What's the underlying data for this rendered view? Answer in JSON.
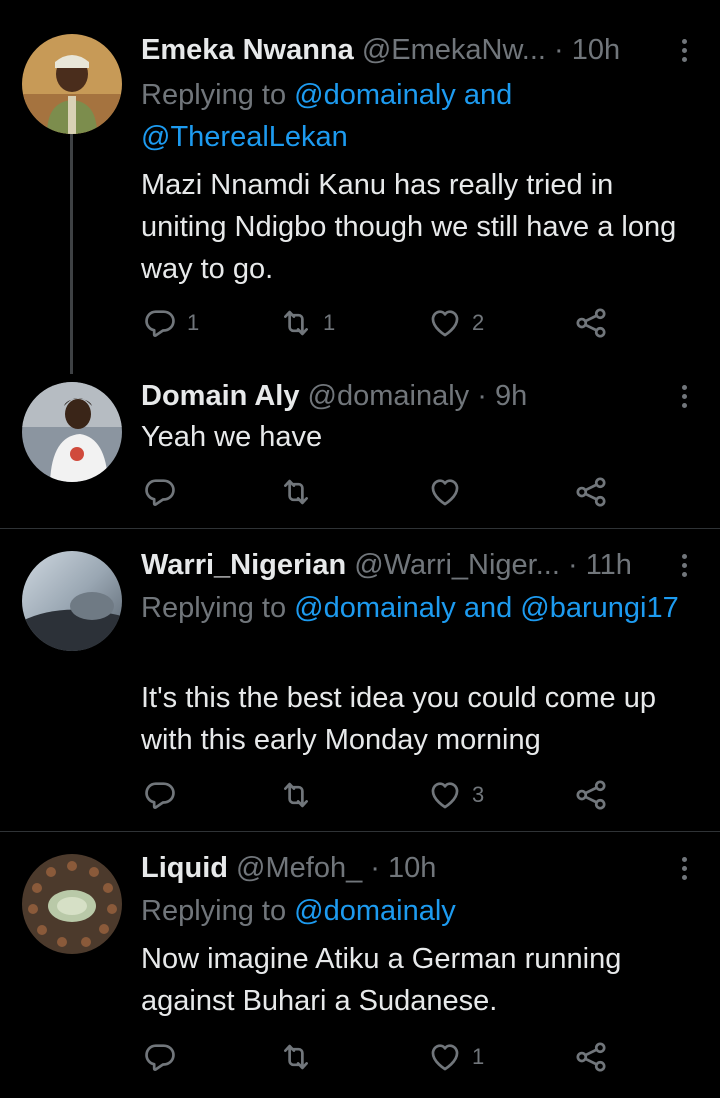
{
  "tweets": [
    {
      "name": "Emeka Nwanna",
      "handle": "@EmekaNw...",
      "dot": "·",
      "time": "10h",
      "replying_prefix": "Replying to ",
      "replying_mentions": "@domainaly and @TherealLekan",
      "text": "Mazi Nnamdi Kanu has really tried in uniting Ndigbo though we still have a long way to go.",
      "counts": {
        "reply": "1",
        "retweet": "1",
        "like": "2"
      }
    },
    {
      "name": "Domain Aly",
      "handle": "@domainaly",
      "dot": "·",
      "time": "9h",
      "text": "Yeah we have",
      "counts": {
        "reply": "",
        "retweet": "",
        "like": ""
      }
    },
    {
      "name": "Warri_Nigerian",
      "handle": "@Warri_Niger...",
      "dot": "·",
      "time": "11h",
      "replying_prefix": "Replying to ",
      "replying_mentions": "@domainaly and @barungi17",
      "text": "It's this the best idea you could come up with this early Monday morning",
      "counts": {
        "reply": "",
        "retweet": "",
        "like": "3"
      }
    },
    {
      "name": "Liquid",
      "handle": "@Mefoh_",
      "dot": "·",
      "time": "10h",
      "replying_prefix": "Replying to ",
      "replying_mentions": "@domainaly",
      "text": "Now imagine Atiku a German running against Buhari a Sudanese.",
      "counts": {
        "reply": "",
        "retweet": "",
        "like": "1"
      }
    }
  ],
  "icons": {
    "reply": "reply-icon",
    "retweet": "retweet-icon",
    "like": "heart-icon",
    "share": "share-icon",
    "more": "more-options-icon"
  },
  "colors": {
    "background": "#000000",
    "primary_text": "#e7e9ea",
    "secondary_text": "#71767b",
    "accent": "#1d9bf0",
    "divider": "#2f3336"
  }
}
